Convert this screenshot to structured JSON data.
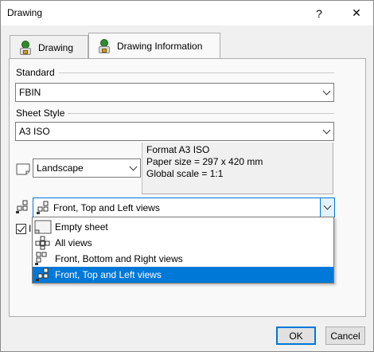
{
  "window": {
    "title": "Drawing",
    "help_label": "?",
    "close_label": "✕"
  },
  "tabs": [
    {
      "label": "Drawing",
      "icon": "user-lock-icon"
    },
    {
      "label": "Drawing Information",
      "icon": "user-lock-icon"
    }
  ],
  "standard": {
    "label": "Standard",
    "value": "FBIN"
  },
  "sheet_style": {
    "label": "Sheet Style",
    "value": "A3 ISO"
  },
  "orientation": {
    "value": "Landscape"
  },
  "info": {
    "line1": "Format A3 ISO",
    "line2": "Paper size = 297 x 420 mm",
    "line3": "Global scale = 1:1"
  },
  "views_combo": {
    "value": "Front, Top and Left views"
  },
  "views_options": [
    {
      "label": "Empty sheet",
      "icon": "empty-sheet-icon"
    },
    {
      "label": "All views",
      "icon": "all-views-icon"
    },
    {
      "label": "Front, Bottom and Right views",
      "icon": "front-bottom-right-views-icon"
    },
    {
      "label": "Front, Top and Left views",
      "icon": "front-top-left-views-icon",
      "selected": true
    }
  ],
  "checkbox": {
    "checked": true,
    "label": "I"
  },
  "buttons": {
    "ok": "OK",
    "cancel": "Cancel"
  },
  "colors": {
    "selection": "#0078d7",
    "panel": "#f9f9f9",
    "window_bg": "#f0f0f0"
  }
}
